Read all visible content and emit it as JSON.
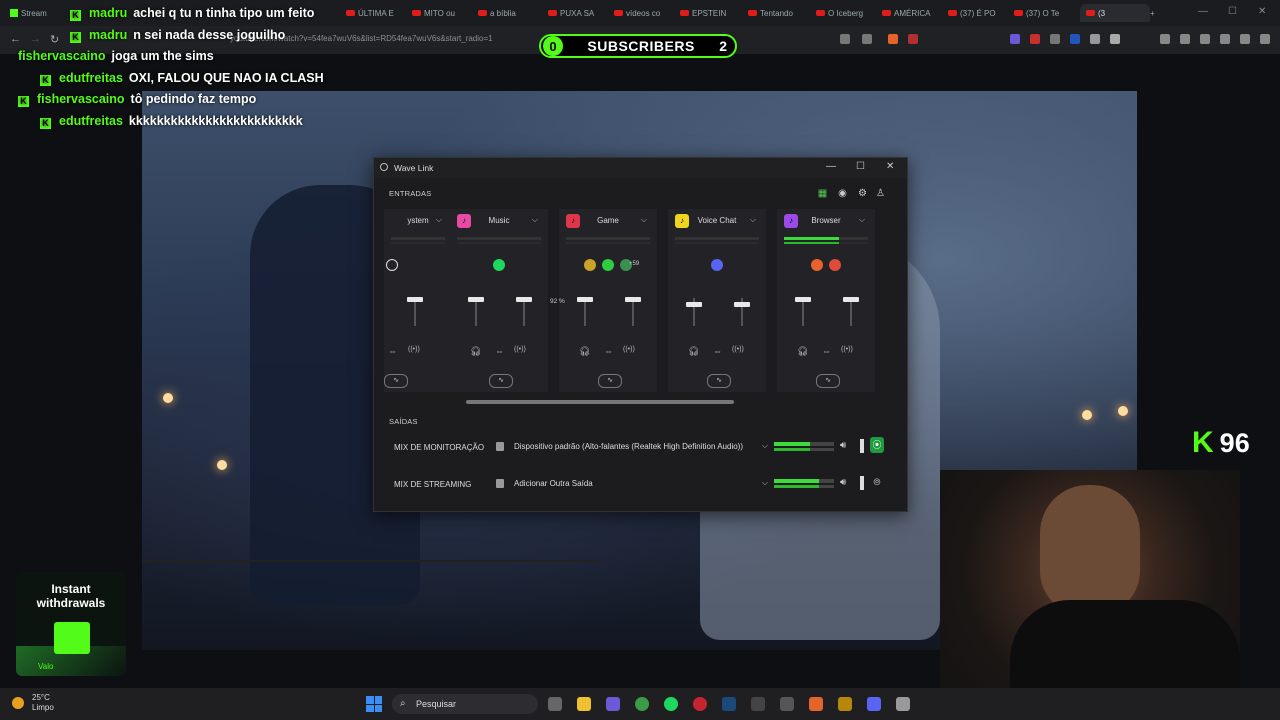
{
  "browser": {
    "tabs": [
      {
        "label": "Stream",
        "kind": "kick"
      },
      {
        "label": "ÚLTIMA E",
        "kind": "yt"
      },
      {
        "label": "MITO ou",
        "kind": "yt"
      },
      {
        "label": "a bíblia",
        "kind": "yt"
      },
      {
        "label": "PUXA SA",
        "kind": "yt"
      },
      {
        "label": "vídeos co",
        "kind": "yt"
      },
      {
        "label": "EPSTEIN",
        "kind": "yt"
      },
      {
        "label": "Tentando",
        "kind": "yt"
      },
      {
        "label": "O Iceberg",
        "kind": "yt"
      },
      {
        "label": "AMÉRICA",
        "kind": "yt"
      },
      {
        "label": "(37) É PO",
        "kind": "yt"
      },
      {
        "label": "(37) O Te",
        "kind": "yt"
      },
      {
        "label": "(3",
        "kind": "yt"
      }
    ],
    "new_tab": "+",
    "url": "youtube.com/watch?v=54fea7wuV6s&list=RD54fea7wuV6s&start_radio=1"
  },
  "chat": [
    {
      "user": "madru",
      "msg": "achei q tu n tinha tipo um feito",
      "badge": "K"
    },
    {
      "user": "madru",
      "msg": "n sei nada desse joguilho",
      "badge": "K"
    },
    {
      "user": "fishervascaino",
      "msg": "joga um the sims",
      "badge": ""
    },
    {
      "user": "edutfreitas",
      "msg": "OXI, FALOU QUE NAO IA CLASH",
      "badge": "K"
    },
    {
      "user": "fishervascaino",
      "msg": "tô pedindo faz tempo",
      "badge": "K"
    },
    {
      "user": "edutfreitas",
      "msg": "kkkkkkkkkkkkkkkkkkkkkkkkk",
      "badge": "K"
    }
  ],
  "subscribers": {
    "left": "0",
    "label": "SUBSCRIBERS",
    "right": "2"
  },
  "viewers": {
    "badge": "K",
    "count": "96"
  },
  "promo": {
    "line1": "Instant",
    "line2": "withdrawals",
    "tag": "Valo"
  },
  "wavelink": {
    "title": "Wave Link",
    "inputs_label": "ENTRADAS",
    "outputs_label": "SAÍDAS",
    "channels": [
      {
        "label": "ystem",
        "color": "#2a2a2e",
        "level": 0.0
      },
      {
        "label": "Music",
        "color": "#e64aa5",
        "level": 0.0
      },
      {
        "label": "Game",
        "color": "#e0364c",
        "level": 0.0
      },
      {
        "label": "Voice Chat",
        "color": "#f0d51e",
        "level": 0.0
      },
      {
        "label": "Browser",
        "color": "#9a4ae6",
        "level": 0.65
      }
    ],
    "game_extra_apps": "+59",
    "fader_tooltip": "92 %",
    "outputs": [
      {
        "name": "MIX DE MONITORAÇÃO",
        "device": "Dispositivo padrão (Alto-falantes (Realtek High Definition Audio))",
        "level": 0.6
      },
      {
        "name": "MIX DE STREAMING",
        "device": "Adicionar Outra Saída",
        "level": 0.75
      }
    ]
  },
  "taskbar": {
    "temp": "25°C",
    "weather": "Limpo",
    "search_placeholder": "Pesquisar"
  }
}
